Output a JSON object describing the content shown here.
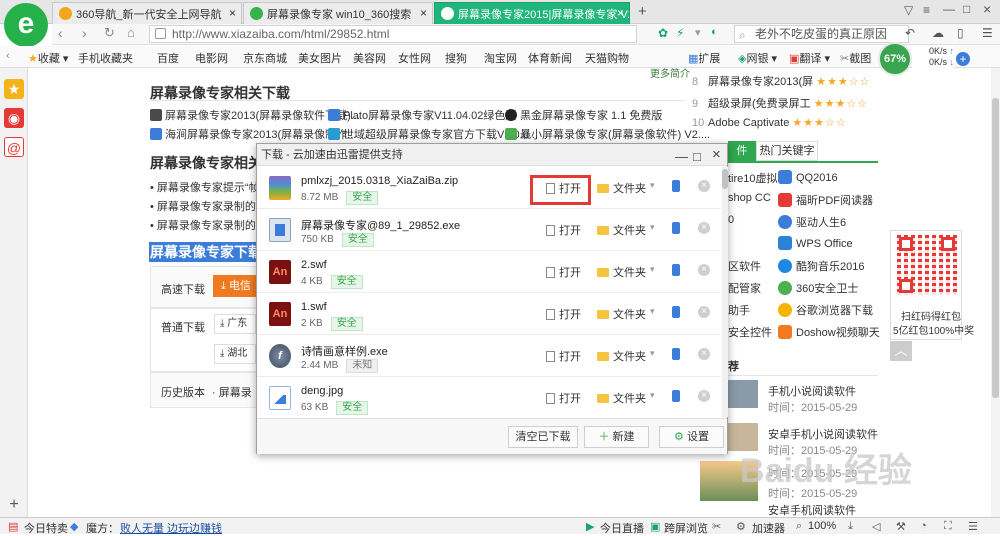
{
  "tabs": [
    {
      "label": "360导航_新一代安全上网导航"
    },
    {
      "label": "屏幕录像专家 win10_360搜索"
    },
    {
      "label": "屏幕录像专家2015|屏幕录像专家 V201"
    }
  ],
  "new_tab": "+",
  "address": {
    "url": "http://www.xiazaiba.com/html/29852.html",
    "search_placeholder": "老外不吃皮蛋的真正原因"
  },
  "bookmarks": [
    "收藏",
    "手机收藏夹",
    "百度",
    "电影网",
    "京东商城",
    "美女图片",
    "美容网",
    "女性网",
    "搜狗",
    "淘宝网",
    "体育新闻",
    "天猫购物",
    "扩展",
    "网银",
    "翻译",
    "截图"
  ],
  "speed_widget": {
    "percent": "67%",
    "up": "0K/s",
    "down": "0K/s"
  },
  "page": {
    "more_link": "更多简介",
    "related_title": "屏幕录像专家相关下载",
    "related_links": [
      "屏幕录像专家2013(屏幕录像软件下载)...",
      "Plato屏幕录像专家V11.04.02绿色版",
      "黑金屏幕录像专家 1.1 免费版",
      "海涧屏幕录像专家2013(屏幕录像制作...",
      "世域超级屏幕录像专家官方下载V1.0.0...",
      "最小屏幕录像专家(屏幕录像软件) V2...."
    ],
    "tutorial_title": "屏幕录像专家相关教",
    "tutorial_items": [
      "屏幕录像专家提示“帧数",
      "屏幕录像专家录制的视频",
      "屏幕录像专家录制的视频"
    ],
    "download_section_title": "屏幕录像专家下载地",
    "high_speed_label": "高速下载",
    "high_speed_button": "电信",
    "normal_label": "普通下载",
    "mirror1": "广东",
    "mirror2": "湖北",
    "history_label": "历史版本",
    "history_item": "屏幕录"
  },
  "ranking": [
    {
      "num": "8",
      "name": "屏幕录像专家2013(屏",
      "stars": "★★★☆☆"
    },
    {
      "num": "9",
      "name": "超级录屏(免费录屏工",
      "stars": "★★★☆☆"
    },
    {
      "num": "10",
      "name": "Adobe Captivate",
      "stars": "★★★☆☆"
    }
  ],
  "right_tabs": [
    "件",
    "热门关键字"
  ],
  "software_grid": [
    "QQ2016",
    "福昕PDF阅读器",
    "驱动人生6",
    "WPS Office",
    "酷狗音乐2016",
    "360安全卫士",
    "谷歌浏览器下载",
    "Doshow视频聊天"
  ],
  "software_left_partial": [
    "tire10虚拟机",
    "shop CC",
    "0",
    "",
    "区软件",
    "配管家",
    "助手",
    "安全控件"
  ],
  "recommend_partial": "荐",
  "news": [
    {
      "title": "手机小说阅读软件",
      "date": "时间：2015-05-29"
    },
    {
      "title": "安卓手机小说阅读软件",
      "date": "时间：2015-05-29"
    },
    {
      "title": "",
      "date": "时间：2015-05-29"
    },
    {
      "title": "",
      "date": "时间：2015-05-29"
    },
    {
      "title": "安卓手机阅读软件",
      "date": ""
    }
  ],
  "qr_caption1": "扫红码得红包",
  "qr_caption2": "5亿红包100%中奖",
  "watermark": "Baidu 经验",
  "dialog": {
    "title": "下载 - 云加速由迅雷提供支持",
    "items": [
      {
        "name": "pmlxzj_2015.0318_XiaZaiBa.zip",
        "size": "8.72 MB",
        "tag": "安全",
        "icon": "zip-icon"
      },
      {
        "name": "屏幕录像专家@89_1_29852.exe",
        "size": "750 KB",
        "tag": "安全",
        "icon": "exe-icon"
      },
      {
        "name": "2.swf",
        "size": "4 KB",
        "tag": "安全",
        "icon": "an-icon"
      },
      {
        "name": "1.swf",
        "size": "2 KB",
        "tag": "安全",
        "icon": "an-icon"
      },
      {
        "name": "诗情画意样例.exe",
        "size": "2.44 MB",
        "tag": "未知",
        "icon": "flash-icon"
      },
      {
        "name": "deng.jpg",
        "size": "63 KB",
        "tag": "安全",
        "icon": "image-icon"
      }
    ],
    "open_label": "打开",
    "folder_label": "文件夹",
    "clear_button": "清空已下载",
    "new_button": "新建",
    "settings_button": "设置"
  },
  "status": {
    "today": "今日特卖",
    "magic": "魔方：",
    "news_link": "败人无量 边玩边赚钱",
    "live": "今日直播",
    "cross": "跨屏浏览",
    "accel": "加速器",
    "zoom": "100%"
  },
  "colors": {
    "accent": "#1fb57b",
    "highlight": "#e53935",
    "brand_green": "#25b04a",
    "download_orange": "#f07a1f"
  }
}
